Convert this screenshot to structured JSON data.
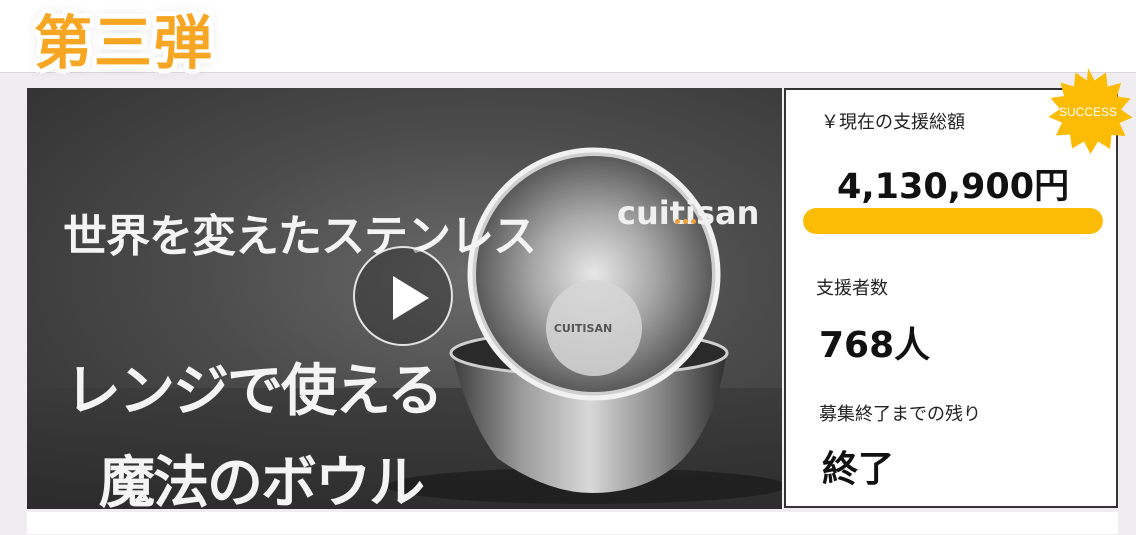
{
  "campaign_label": "第三弾",
  "video": {
    "headline": "世界を変えたステンレス",
    "subline_1": "レンジで使える",
    "subline_2": "魔法のボウル",
    "brand_logo": "cuitisan",
    "bowl_emblem": "CUITISAN",
    "play_icon": "play-icon"
  },
  "funding": {
    "total_label": "￥現在の支援総額",
    "total_value": "4,130,900円",
    "progress_fraction": 1.0,
    "backers_label": "支援者数",
    "backers_value": "768人",
    "remaining_label": "募集終了までの残り",
    "remaining_value": "終了",
    "status_badge": "SUCCESS"
  },
  "colors": {
    "campaign_label": "#f6a623",
    "progress": "#fcbc05",
    "badge": "#fcbc05",
    "border": "#333333"
  }
}
